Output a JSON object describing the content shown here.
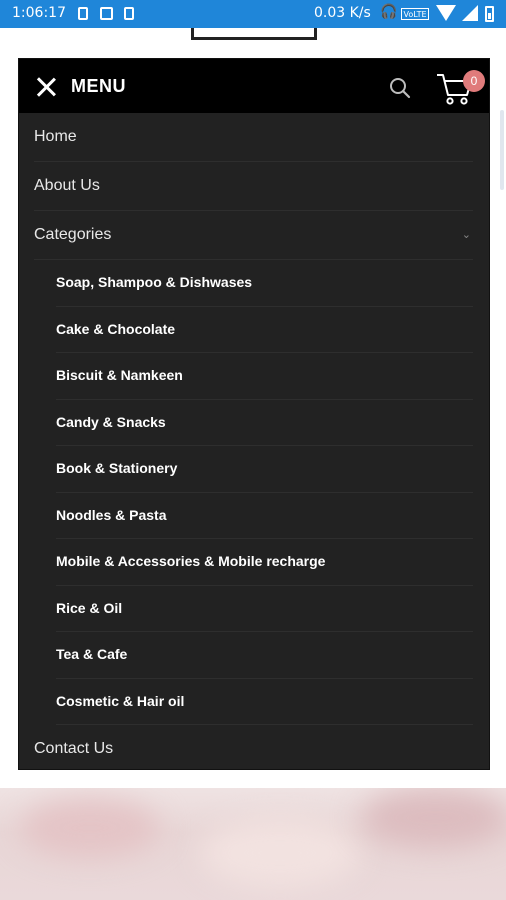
{
  "status_bar": {
    "time": "1:06:17",
    "net_speed": "0.03 K/s",
    "volte": "VoLTE",
    "background": "#1f86d9"
  },
  "menu": {
    "title": "MENU",
    "cart_count": "0",
    "accent": "#e07b7b",
    "items": [
      {
        "label": "Home"
      },
      {
        "label": "About Us"
      },
      {
        "label": "Categories",
        "expanded": true
      }
    ],
    "categories": [
      "Soap, Shampoo & Dishwases",
      "Cake & Chocolate",
      "Biscuit & Namkeen",
      "Candy & Snacks",
      "Book & Stationery",
      "Noodles & Pasta",
      "Mobile & Accessories & Mobile recharge",
      "Rice & Oil",
      "Tea & Cafe",
      "Cosmetic & Hair oil"
    ],
    "footer_item": "Contact Us"
  },
  "icons": {
    "close": "close-icon",
    "search": "search-icon",
    "cart": "cart-icon",
    "chevron": "chevron-down-icon"
  }
}
